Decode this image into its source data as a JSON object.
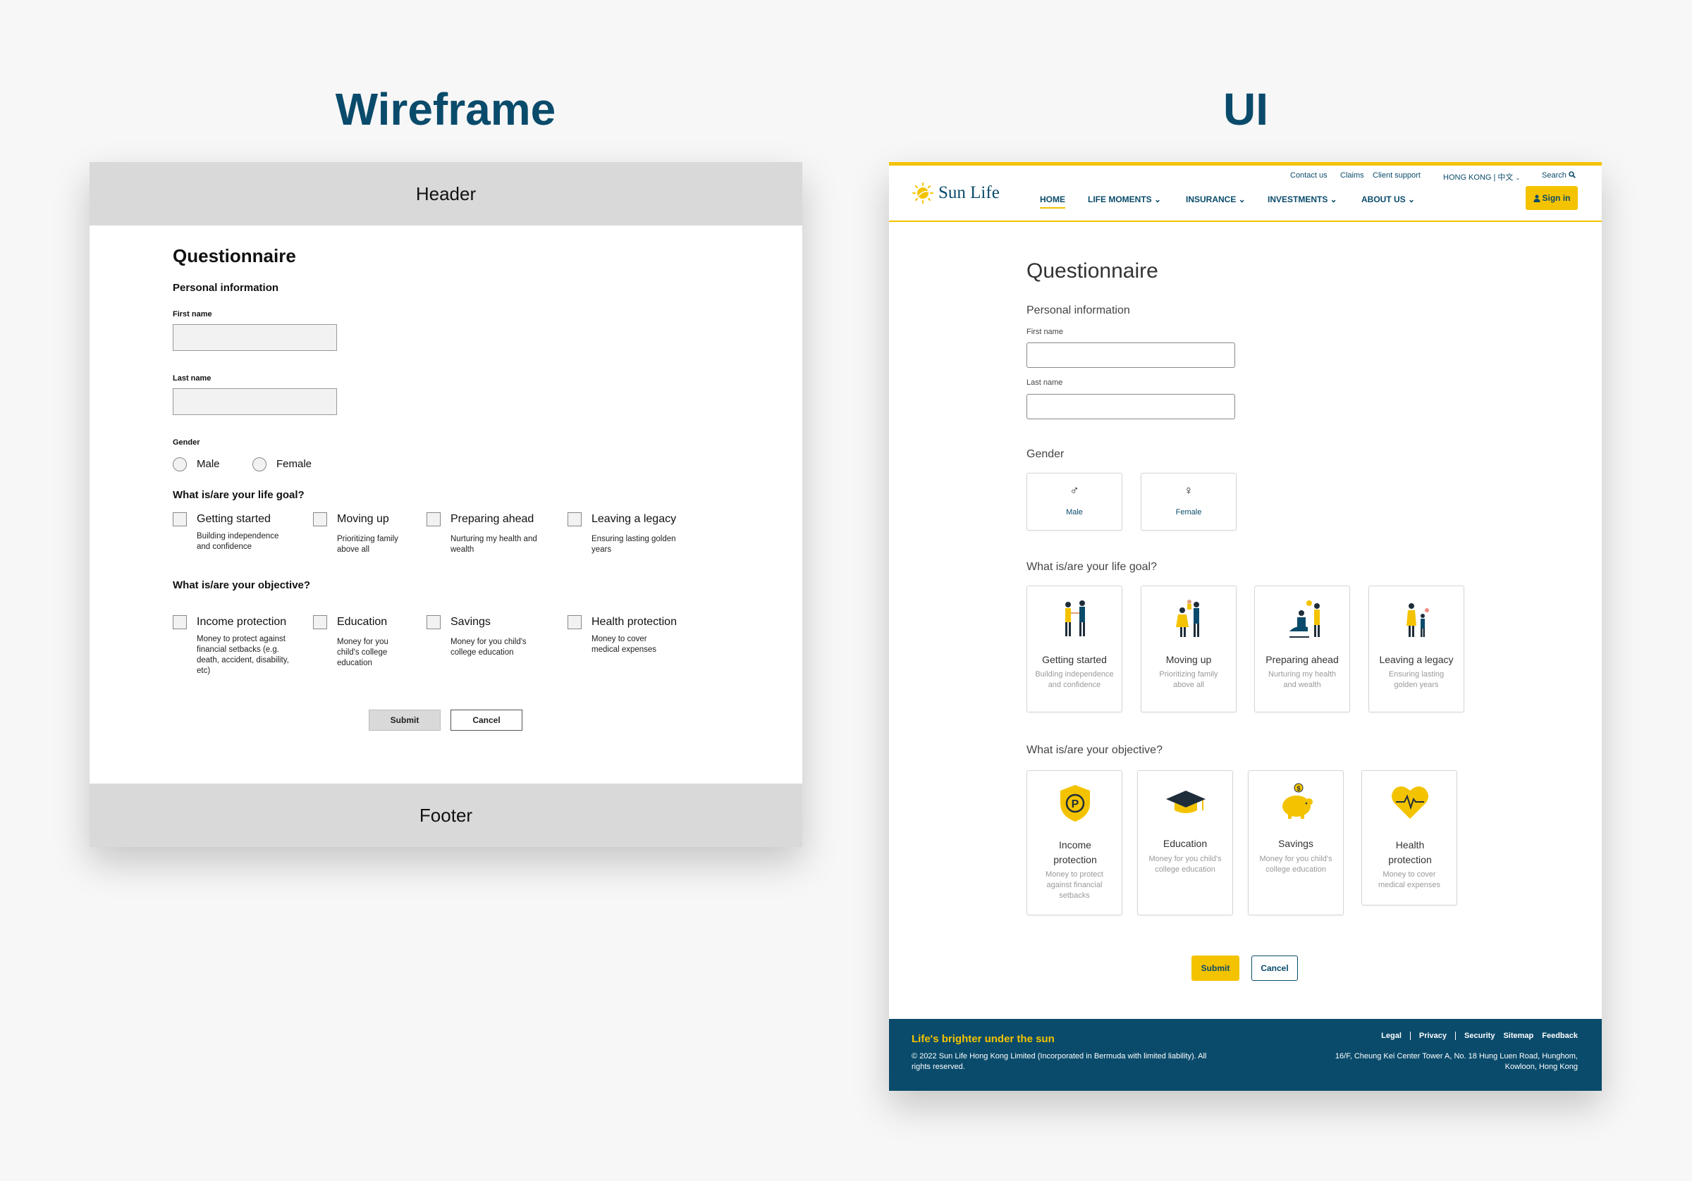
{
  "headings": {
    "wireframe": "Wireframe",
    "ui": "UI"
  },
  "wireframe": {
    "header": "Header",
    "footer": "Footer",
    "title": "Questionnaire",
    "section_personal": "Personal information",
    "first_name_label": "First name",
    "last_name_label": "Last name",
    "gender_label": "Gender",
    "gender_options": [
      "Male",
      "Female"
    ],
    "life_goal_question": "What is/are your life goal?",
    "life_goals": [
      {
        "title": "Getting started",
        "desc": "Building independence and confidence"
      },
      {
        "title": "Moving up",
        "desc": "Prioritizing family above all"
      },
      {
        "title": "Preparing ahead",
        "desc": "Nurturing my health and wealth"
      },
      {
        "title": "Leaving a legacy",
        "desc": "Ensuring lasting golden years"
      }
    ],
    "objective_question": "What is/are your objective?",
    "objectives": [
      {
        "title": "Income protection",
        "desc": "Money to protect against financial setbacks (e.g. death, accident, disability, etc)"
      },
      {
        "title": "Education",
        "desc": "Money for you child's college education"
      },
      {
        "title": "Savings",
        "desc": "Money for you child's college education"
      },
      {
        "title": "Health protection",
        "desc": "Money to cover medical expenses"
      }
    ],
    "submit": "Submit",
    "cancel": "Cancel"
  },
  "ui": {
    "logo_text": "Sun Life",
    "utility_links": [
      "Contact us",
      "Claims",
      "Client support",
      "HONG KONG | 中文",
      "Search"
    ],
    "nav": [
      "HOME",
      "LIFE MOMENTS",
      "INSURANCE",
      "INVESTMENTS",
      "ABOUT US"
    ],
    "sign_in": "Sign in",
    "title": "Questionnaire",
    "section_personal": "Personal information",
    "first_name_label": "First name",
    "last_name_label": "Last name",
    "first_name_value": "",
    "last_name_value": "",
    "gender_label": "Gender",
    "gender_options": [
      {
        "label": "Male",
        "symbol": "♂"
      },
      {
        "label": "Female",
        "symbol": "♀"
      }
    ],
    "life_goal_question": "What is/are your life goal?",
    "life_goals": [
      {
        "title": "Getting started",
        "desc": "Building independence and confidence"
      },
      {
        "title": "Moving up",
        "desc": "Prioritizing family above all"
      },
      {
        "title": "Preparing ahead",
        "desc": "Nurturing my health and wealth"
      },
      {
        "title": "Leaving a legacy",
        "desc": "Ensuring lasting golden years"
      }
    ],
    "objective_question": "What is/are your objective?",
    "objectives": [
      {
        "title": "Income protection",
        "desc": "Money to protect against financial setbacks"
      },
      {
        "title": "Education",
        "desc": "Money for you child's college education"
      },
      {
        "title": "Savings",
        "desc": "Money for you child's college education"
      },
      {
        "title": "Health protection",
        "desc": "Money to cover medical expenses"
      }
    ],
    "submit": "Submit",
    "cancel": "Cancel",
    "footer": {
      "tagline": "Life's brighter under the sun",
      "copyright": "© 2022 Sun Life Hong Kong Limited (Incorporated in Bermuda with limited liability). All rights reserved.",
      "links": [
        "Legal",
        "Privacy",
        "Security",
        "Sitemap",
        "Feedback"
      ],
      "address": "16/F, Cheung Kei Center Tower A,  No. 18 Hung Luen Road, Hunghom, Kowloon, Hong Kong"
    }
  },
  "colors": {
    "brand_yellow": "#f4c300",
    "brand_navy": "#0a4b6b",
    "wireframe_gray": "#d9d9d9"
  }
}
